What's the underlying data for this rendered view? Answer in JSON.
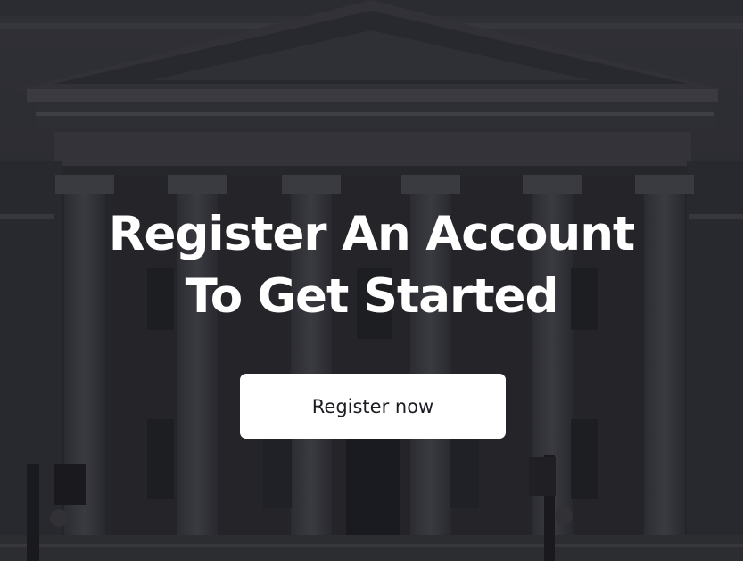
{
  "hero": {
    "headline_line1": "Register An Account",
    "headline_line2": "To Get Started",
    "cta_label": "Register now"
  },
  "colors": {
    "text": "#ffffff",
    "button_bg": "#ffffff",
    "button_text": "#1c1d22",
    "background": "#2e2f33"
  },
  "background_image": "neoclassical-building-facade"
}
